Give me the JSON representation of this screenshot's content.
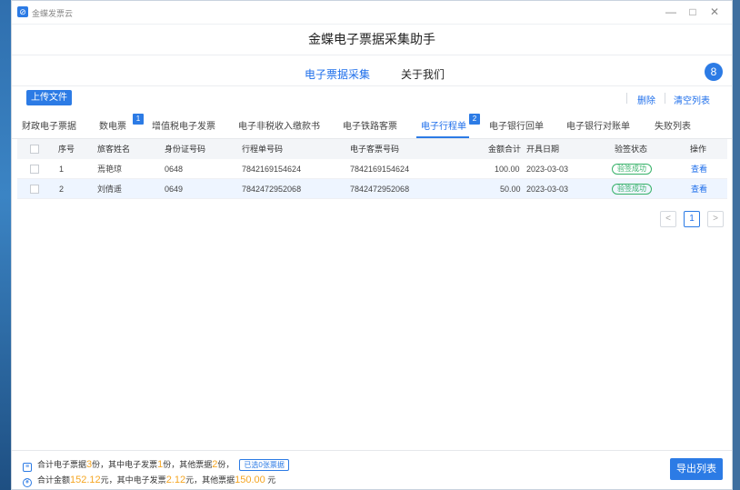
{
  "window": {
    "app_name": "金蝶发票云",
    "title": "金蝶电子票据采集助手",
    "min_symbol": "—",
    "max_symbol": "□",
    "close_symbol": "✕"
  },
  "nav": {
    "collect": "电子票据采集",
    "about": "关于我们",
    "avatar_glyph": "8"
  },
  "toolbar": {
    "upload": "上传文件",
    "delete": "删除",
    "clear": "清空列表"
  },
  "tabs": [
    {
      "label": "财政电子票据"
    },
    {
      "label": "数电票",
      "badge": "1"
    },
    {
      "label": "增值税电子发票"
    },
    {
      "label": "电子非税收入缴款书"
    },
    {
      "label": "电子铁路客票"
    },
    {
      "label": "电子行程单",
      "badge": "2",
      "active": true
    },
    {
      "label": "电子银行回单"
    },
    {
      "label": "电子银行对账单"
    },
    {
      "label": "失败列表"
    }
  ],
  "table": {
    "headers": {
      "seq": "序号",
      "name": "旅客姓名",
      "id": "身份证号码",
      "trip_no": "行程单号码",
      "ticket_no": "电子客票号码",
      "amount": "金额合计",
      "date": "开具日期",
      "status": "验签状态",
      "op": "操作"
    },
    "rows": [
      {
        "seq": "1",
        "name": "焉艳琼",
        "id": "0648",
        "trip_no": "7842169154624",
        "ticket_no": "7842169154624",
        "amount": "100.00",
        "date": "2023-03-03",
        "status": "验签成功",
        "op": "查看"
      },
      {
        "seq": "2",
        "name": "刘倩遥",
        "id": "0649",
        "trip_no": "7842472952068",
        "ticket_no": "7842472952068",
        "amount": "50.00",
        "date": "2023-03-03",
        "status": "验签成功",
        "op": "查看"
      }
    ]
  },
  "pagination": {
    "prev": "<",
    "current": "1",
    "next": ">"
  },
  "footer": {
    "line1_a": "合计电子票据",
    "line1_total": "3",
    "line1_b": "份，其中电子发票",
    "line1_inv": "1",
    "line1_c": "份，其他票据",
    "line1_other": "2",
    "line1_d": "份，",
    "selected": "已选0张票据",
    "line2_a": "合计金额",
    "line2_total": "152.12",
    "line2_b": "元，其中电子发票",
    "line2_inv": "2.12",
    "line2_c": "元，其他票据",
    "line2_other": "150.00",
    "line2_d": " 元"
  },
  "export": "导出列表",
  "colors": {
    "accent": "#2c7be5",
    "success": "#38b26a",
    "highlight": "#f5a623"
  }
}
